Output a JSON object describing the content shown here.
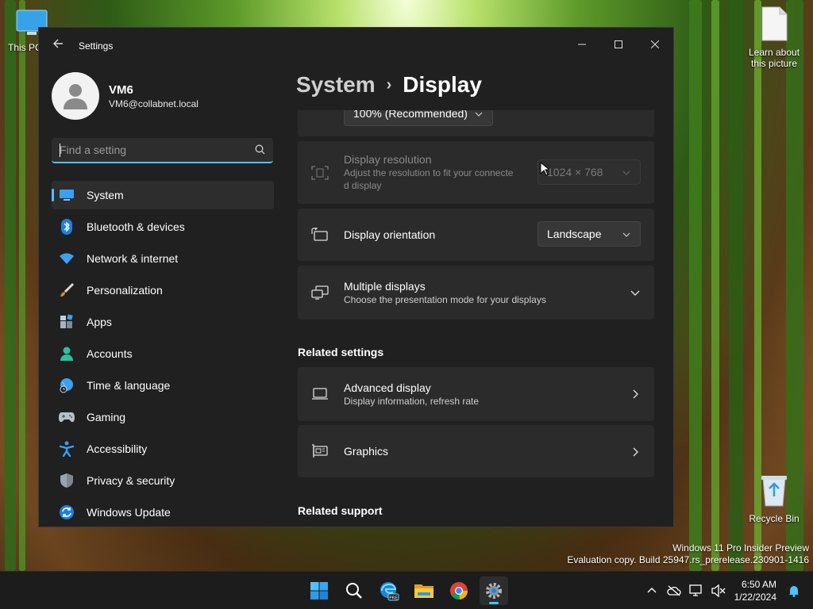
{
  "desktop": {
    "icons": [
      {
        "label": "This PC"
      },
      {
        "label": "Learn about this picture"
      },
      {
        "label": "Recycle Bin"
      }
    ],
    "watermark": {
      "line1": "Windows 11 Pro Insider Preview",
      "line2": "Evaluation copy. Build 25947.rs_prerelease.230901-1416"
    }
  },
  "window": {
    "title": "Settings",
    "controls": [
      "minimize",
      "maximize",
      "close"
    ]
  },
  "profile": {
    "name": "VM6",
    "email": "VM6@collabnet.local"
  },
  "search": {
    "placeholder": "Find a setting"
  },
  "sidebar": {
    "items": [
      {
        "label": "System",
        "icon": "system-icon",
        "selected": true
      },
      {
        "label": "Bluetooth & devices",
        "icon": "bluetooth-icon"
      },
      {
        "label": "Network & internet",
        "icon": "wifi-icon"
      },
      {
        "label": "Personalization",
        "icon": "brush-icon"
      },
      {
        "label": "Apps",
        "icon": "apps-icon"
      },
      {
        "label": "Accounts",
        "icon": "accounts-icon"
      },
      {
        "label": "Time & language",
        "icon": "globe-clock-icon"
      },
      {
        "label": "Gaming",
        "icon": "gamepad-icon"
      },
      {
        "label": "Accessibility",
        "icon": "accessibility-icon"
      },
      {
        "label": "Privacy & security",
        "icon": "shield-icon"
      },
      {
        "label": "Windows Update",
        "icon": "update-icon"
      }
    ]
  },
  "breadcrumb": {
    "parent": "System",
    "separator": "›",
    "current": "Display"
  },
  "main": {
    "scale": {
      "value": "100% (Recommended)"
    },
    "resolution": {
      "title": "Display resolution",
      "subtitle_line1": "Adjust the resolution to fit your connecte",
      "subtitle_line2": "d display",
      "value": "1024 × 768",
      "disabled": true
    },
    "orientation": {
      "title": "Display orientation",
      "value": "Landscape"
    },
    "multiple": {
      "title": "Multiple displays",
      "subtitle": "Choose the presentation mode for your displays"
    },
    "related_settings_heading": "Related settings",
    "advanced": {
      "title": "Advanced display",
      "subtitle": "Display information, refresh rate"
    },
    "graphics": {
      "title": "Graphics"
    },
    "related_support_heading": "Related support"
  },
  "taskbar": {
    "apps": [
      "windows-start-icon",
      "search-icon",
      "edge-beta-icon",
      "file-explorer-icon",
      "chrome-icon",
      "settings-icon"
    ],
    "active_app": "settings-icon",
    "clock": {
      "time": "6:50 AM",
      "date": "1/22/2024"
    }
  },
  "colors": {
    "accent": "#4cc2ff",
    "window_bg": "#202020",
    "card_bg": "#2b2b2b",
    "taskbar_bg": "#1c1c1c"
  }
}
